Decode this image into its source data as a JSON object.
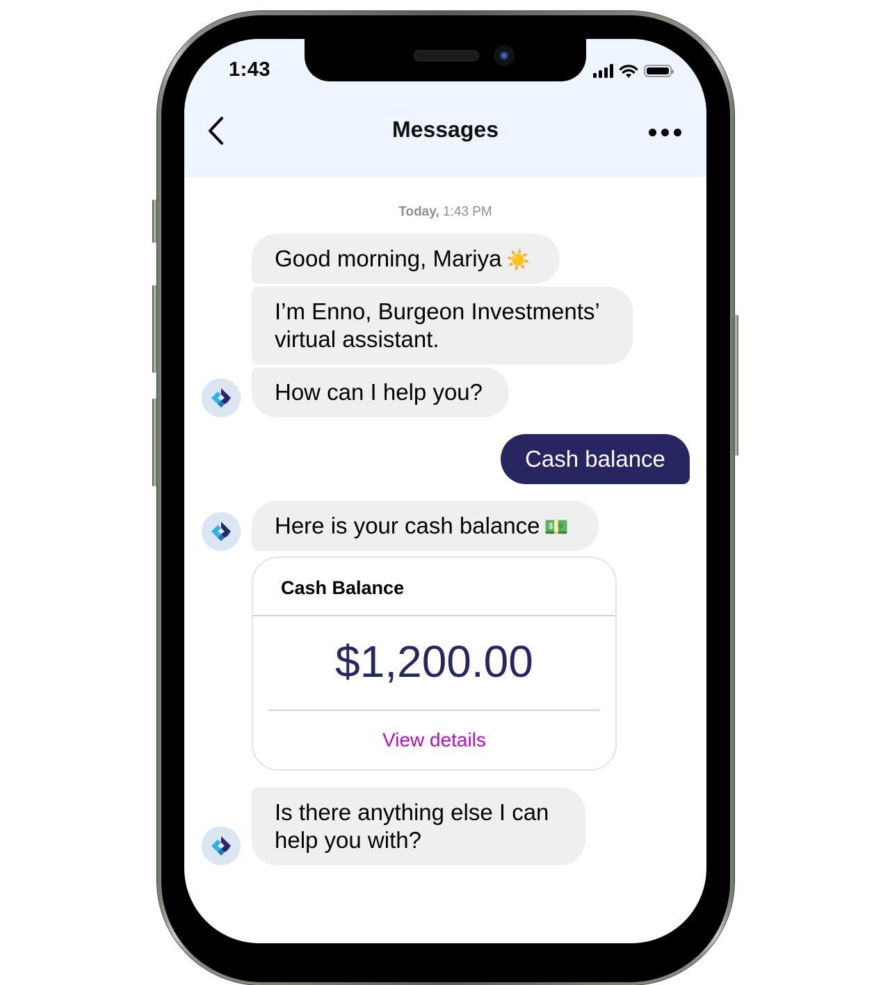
{
  "status_bar": {
    "time": "1:43",
    "icons": [
      "cellular-signal-icon",
      "wifi-icon",
      "battery-icon"
    ]
  },
  "header": {
    "back_icon": "chevron-left-icon",
    "title": "Messages",
    "more_icon": "ellipsis-icon"
  },
  "conversation": {
    "timestamp_day": "Today,",
    "timestamp_time": "1:43 PM",
    "bot_avatar_icon": "assistant-logo-icon",
    "messages": [
      {
        "sender": "bot",
        "text": "Good morning, Mariya",
        "emoji": "☀️"
      },
      {
        "sender": "bot",
        "text": "I’m Enno, Burgeon Investments’ virtual assistant."
      },
      {
        "sender": "bot",
        "text": "How can I help you?"
      },
      {
        "sender": "user",
        "text": "Cash balance"
      },
      {
        "sender": "bot",
        "text": "Here is your cash balance",
        "emoji": "💵"
      },
      {
        "sender": "bot",
        "text": "Is there anything else I can help you with?"
      }
    ],
    "balance_card": {
      "title": "Cash Balance",
      "amount": "$1,200.00",
      "link_label": "View details"
    }
  },
  "colors": {
    "header_bg": "#EEF5FE",
    "bot_bubble": "#EFEFEF",
    "user_bubble": "#282661",
    "amount": "#282661",
    "link": "#B00DBD"
  }
}
